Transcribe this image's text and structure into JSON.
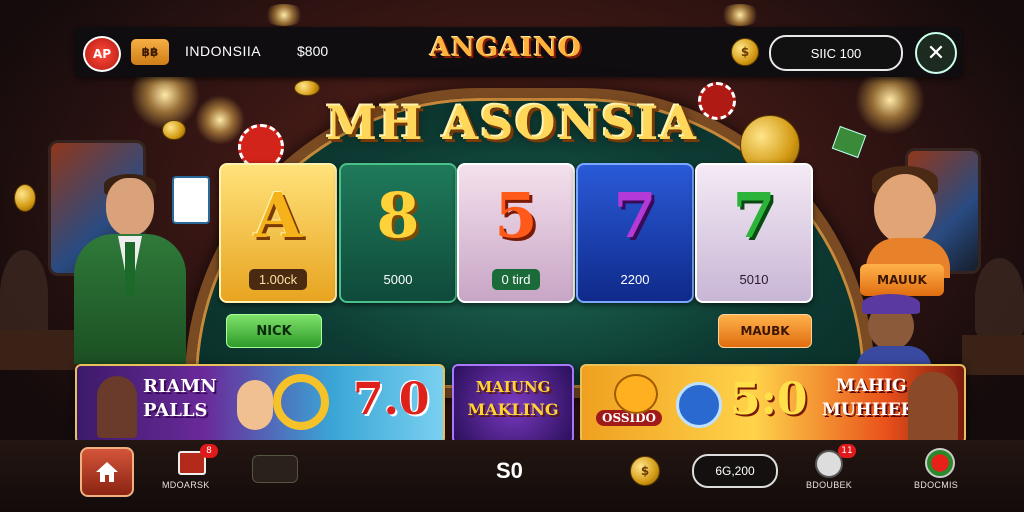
{
  "topbar": {
    "ap_badge": "AP",
    "flag_label": "฿฿",
    "country": "INDONSIIA",
    "balance": "$800",
    "logo": "ANGAINO",
    "coin_symbol": "$",
    "credit_pill": "SIIC 100",
    "close_icon": "✕"
  },
  "main": {
    "title": "MH ASONSIA",
    "reels": [
      {
        "symbol": "A",
        "value": "1.00ck"
      },
      {
        "symbol": "8",
        "value": "5000"
      },
      {
        "symbol": "5",
        "value": "0 tird"
      },
      {
        "symbol": "7",
        "value": "2200"
      },
      {
        "symbol": "7",
        "value": "5010"
      }
    ],
    "left_button": "NICK",
    "right_button": "MAUBK",
    "side_button": "MAUUK"
  },
  "banners": [
    {
      "text_a": "RIAMN",
      "text_b": "PALLS",
      "value": "7.0"
    },
    {
      "text_a": "MAIUNG",
      "text_b": "MAKLING"
    },
    {
      "logo": "OSSIDO",
      "value": "5:0",
      "text_a": "MAHIG",
      "text_b": "MUHHEK"
    }
  ],
  "bottombar": {
    "home_icon": "home-icon",
    "items": [
      {
        "label": "MDOARSK",
        "badge": "8"
      },
      {
        "label": "",
        "badge": ""
      },
      {
        "label": "BDOUBEK",
        "badge": "11"
      },
      {
        "label": "BDOCMIS",
        "badge": ""
      }
    ],
    "count": "S0",
    "coin_symbol": "$",
    "pill": "6G,200"
  },
  "colors": {
    "accent_gold": "#ffd75a",
    "felt_green": "#0d3b33",
    "wood": "#7a4a22"
  }
}
